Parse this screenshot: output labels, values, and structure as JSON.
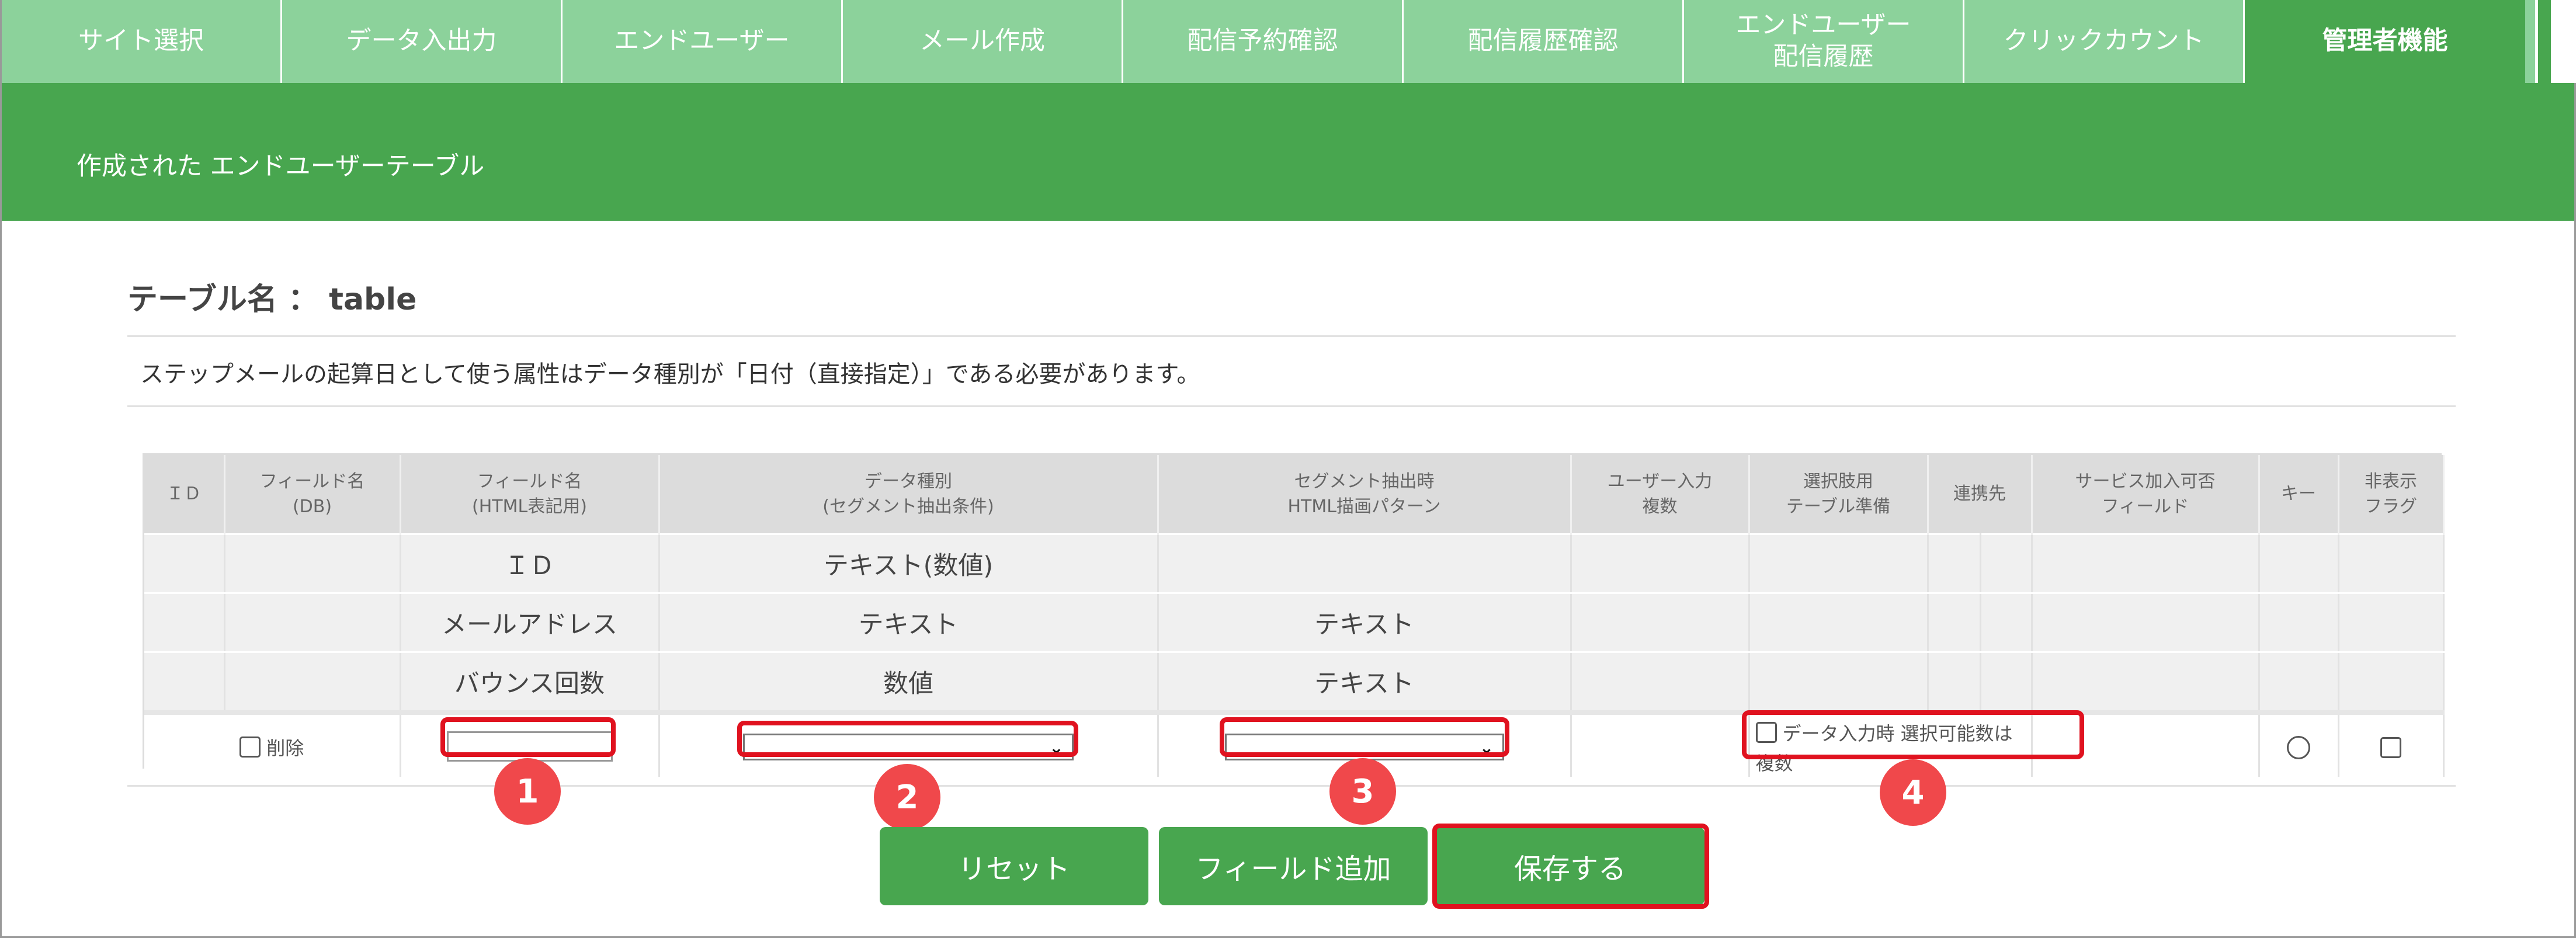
{
  "nav": {
    "tabs": [
      {
        "label": "サイト選択"
      },
      {
        "label": "データ入出力"
      },
      {
        "label": "エンドユーザー"
      },
      {
        "label": "メール作成"
      },
      {
        "label": "配信予約確認"
      },
      {
        "label": "配信履歴確認"
      },
      {
        "label": "エンドユーザー\n配信履歴"
      },
      {
        "label": "クリックカウント"
      },
      {
        "label": "管理者機能",
        "active": true
      }
    ]
  },
  "banner": {
    "title": "作成された エンドユーザーテーブル"
  },
  "table_name": {
    "label": "テーブル名 ： table"
  },
  "notice": "ステップメールの起算日として使う属性はデータ種別が「日付（直接指定）」である必要があります。",
  "grid": {
    "headers": [
      "ＩＤ",
      "フィールド名\n(DB)",
      "フィールド名\n(HTML表記用)",
      "データ種別\n(セグメント抽出条件)",
      "セグメント抽出時\nHTML描画パターン",
      "ユーザー入力\n複数",
      "選択肢用\nテーブル準備",
      "連携先",
      "サービス加入可否\nフィールド",
      "キー",
      "非表示\nフラグ"
    ],
    "rows": [
      {
        "html_name": "ＩＤ",
        "data_type": "テキスト(数値)",
        "pattern": ""
      },
      {
        "html_name": "メールアドレス",
        "data_type": "テキスト",
        "pattern": "テキスト"
      },
      {
        "html_name": "バウンス回数",
        "data_type": "数値",
        "pattern": "テキスト"
      }
    ],
    "input_row": {
      "delete_label": "削除",
      "field_name_value": "",
      "data_type_selected": "",
      "pattern_selected": "",
      "data_input_label": "データ入力時",
      "multi_select_label": "選択可能数は複数"
    }
  },
  "badges": [
    "1",
    "2",
    "3",
    "4"
  ],
  "buttons": {
    "reset": "リセット",
    "add_field": "フィールド追加",
    "save": "保存する"
  },
  "colors": {
    "nav_tab": "#8cd29b",
    "primary_green": "#48a64f",
    "highlight_red": "#e0121f",
    "badge_red": "#f0484b"
  }
}
